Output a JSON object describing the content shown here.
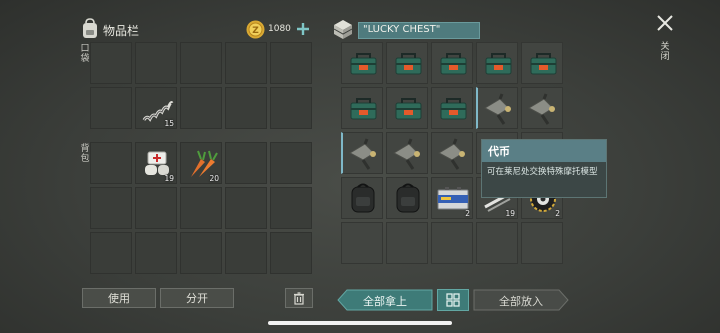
{
  "inventory": {
    "title": "物品栏",
    "currency": "1080",
    "quick_label": "口袋",
    "backpack_label": "背包",
    "quick_items": [
      {
        "slot": 6,
        "icon": "spring-coil",
        "count": "15"
      }
    ],
    "backpack_items": [
      {
        "slot": 1,
        "icon": "bandage-kit",
        "count": "19"
      },
      {
        "slot": 2,
        "icon": "carrots",
        "count": "20"
      }
    ]
  },
  "chest": {
    "title": "\"LUCKY CHEST\"",
    "items": [
      {
        "slot": 0,
        "icon": "toolbox",
        "count": ""
      },
      {
        "slot": 1,
        "icon": "toolbox",
        "count": ""
      },
      {
        "slot": 2,
        "icon": "toolbox",
        "count": ""
      },
      {
        "slot": 3,
        "icon": "toolbox",
        "count": ""
      },
      {
        "slot": 4,
        "icon": "toolbox",
        "count": ""
      },
      {
        "slot": 5,
        "icon": "toolbox",
        "count": ""
      },
      {
        "slot": 6,
        "icon": "toolbox",
        "count": ""
      },
      {
        "slot": 7,
        "icon": "toolbox",
        "count": ""
      },
      {
        "slot": 8,
        "icon": "motorcycle-part",
        "count": ""
      },
      {
        "slot": 9,
        "icon": "motorcycle-part",
        "count": ""
      },
      {
        "slot": 10,
        "icon": "motorcycle-part",
        "count": ""
      },
      {
        "slot": 11,
        "icon": "motorcycle-part",
        "count": ""
      },
      {
        "slot": 12,
        "icon": "motorcycle-part",
        "count": ""
      },
      {
        "slot": 15,
        "icon": "backpack",
        "count": ""
      },
      {
        "slot": 16,
        "icon": "backpack",
        "count": ""
      },
      {
        "slot": 17,
        "icon": "battery",
        "count": "2"
      },
      {
        "slot": 18,
        "icon": "tools",
        "count": "19"
      },
      {
        "slot": 19,
        "icon": "token-gear",
        "count": "2"
      }
    ]
  },
  "tooltip": {
    "title": "代币",
    "description": "可在莱尼处交换特殊摩托模型"
  },
  "buttons": {
    "use": "使用",
    "split": "分开",
    "take_all": "全部拿上",
    "put_all": "全部放入",
    "close": "关闭"
  }
}
